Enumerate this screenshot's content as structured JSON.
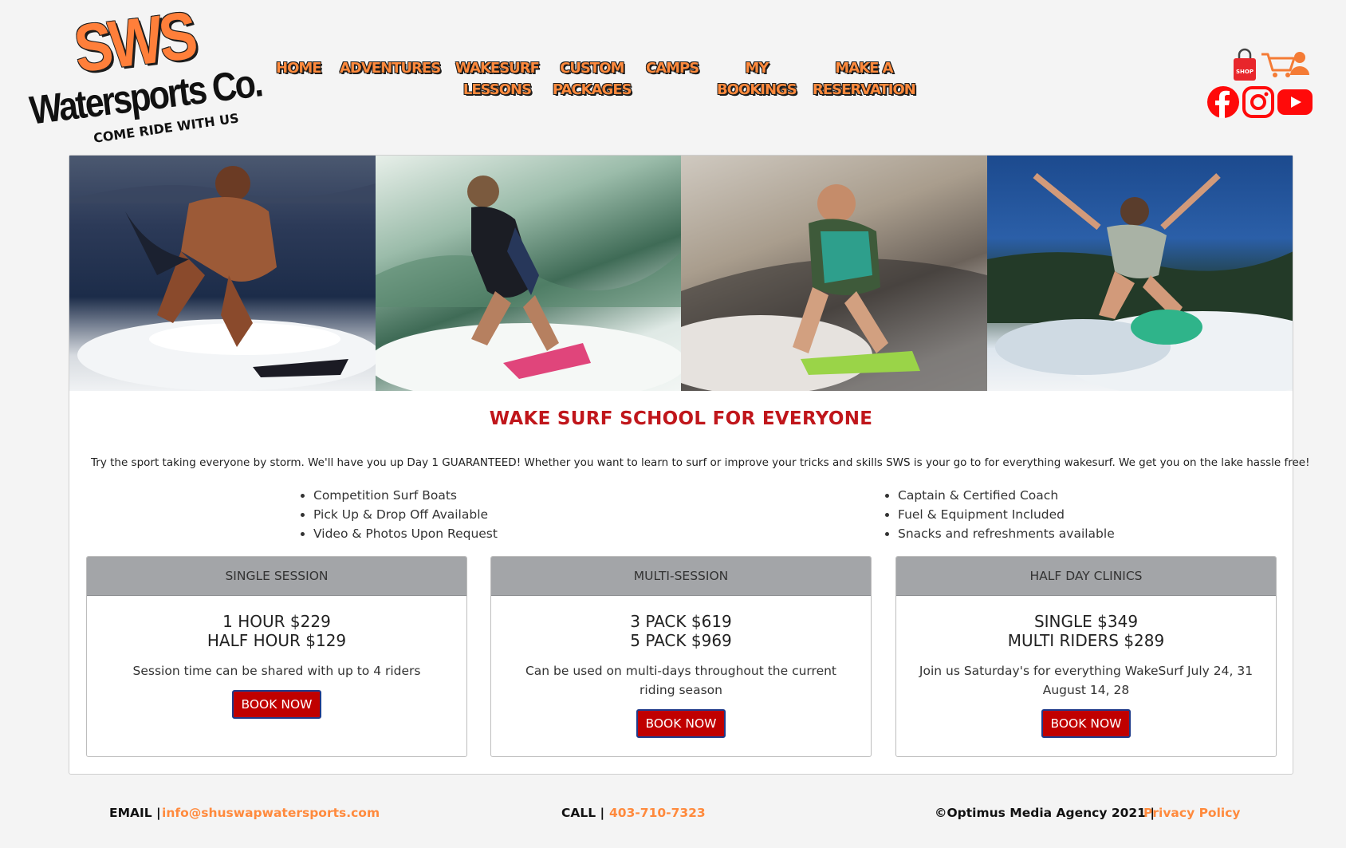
{
  "logo": {
    "brand": "SWS",
    "company": "Watersports Co.",
    "tagline": "COME RIDE WITH US"
  },
  "nav": [
    {
      "label": "HOME",
      "lines": [
        "HOME"
      ]
    },
    {
      "label": "ADVENTURES",
      "lines": [
        "ADVENTURES"
      ]
    },
    {
      "label": "WAKESURF LESSONS",
      "lines": [
        "WAKESURF",
        "LESSONS"
      ]
    },
    {
      "label": "CUSTOM PACKAGES",
      "lines": [
        "CUSTOM",
        "PACKAGES"
      ]
    },
    {
      "label": "CAMPS",
      "lines": [
        "CAMPS"
      ]
    },
    {
      "label": "MY BOOKINGS",
      "lines": [
        "MY",
        "BOOKINGS"
      ]
    },
    {
      "label": "MAKE A RESERVATION",
      "lines": [
        "MAKE A",
        "RESERVATION"
      ]
    }
  ],
  "icons": {
    "shop": "shop-bag-icon",
    "shop_label": "SHOP",
    "cart": "cart-user-icon",
    "facebook": "facebook-icon",
    "instagram": "instagram-icon",
    "youtube": "youtube-icon"
  },
  "main": {
    "heading": "WAKE SURF SCHOOL FOR EVERYONE",
    "intro": "Try the sport taking everyone by storm. We'll have you up Day 1 GUARANTEED! Whether you want to learn to surf or improve your tricks and skills SWS is your go to for everything wakesurf. We get you on the lake hassle free!",
    "features_left": [
      "Competition Surf Boats",
      "Pick Up & Drop Off Available",
      "Video & Photos Upon Request"
    ],
    "features_right": [
      "Captain & Certified Coach",
      "Fuel & Equipment Included",
      "Snacks and refreshments available"
    ],
    "packages": [
      {
        "title": "SINGLE SESSION",
        "price_line1": "1 HOUR $229",
        "price_line2": "HALF HOUR $129",
        "description": "Session time can be shared with up to 4 riders",
        "button": "BOOK NOW"
      },
      {
        "title": "MULTI-SESSION",
        "price_line1": "3 PACK $619",
        "price_line2": "5 PACK $969",
        "description": "Can be used on multi-days throughout the current riding season",
        "button": "BOOK NOW"
      },
      {
        "title": "HALF DAY CLINICS",
        "price_line1": "SINGLE $349",
        "price_line2": "MULTI RIDERS $289",
        "description": "Join us Saturday's for everything WakeSurf July 24, 31 August 14, 28",
        "button": "BOOK NOW"
      }
    ]
  },
  "footer": {
    "email_label": "EMAIL |",
    "email": "info@shuswapwatersports.com",
    "call_label": "CALL |",
    "phone": "403-710-7323",
    "copyright": "©Optimus Media Agency 2021 |",
    "privacy": "Privacy Policy"
  },
  "colors": {
    "accent_orange": "#ff8a3d",
    "heading_red": "#c0161b",
    "button_red": "#c00000",
    "panel_grey": "#a3a5a8"
  }
}
